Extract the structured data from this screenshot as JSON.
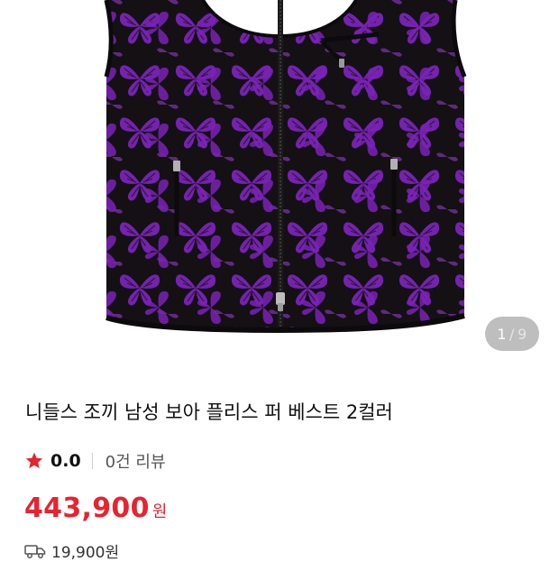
{
  "gallery": {
    "image_alt": "purple butterfly pattern fleece vest",
    "counter": {
      "current": "1",
      "separator": "/",
      "total": "9"
    }
  },
  "product": {
    "title": "니들스 조끼 남성 보아 플리스 퍼 베스트 2컬러",
    "rating": {
      "score": "0.0",
      "reviews": "0건 리뷰"
    },
    "price": {
      "amount": "443,900",
      "unit": "원"
    },
    "shipping": {
      "fee": "19,900원"
    }
  },
  "colors": {
    "price": "#e7232f",
    "star": "#e7232f",
    "vest_black": "#141014",
    "vest_purple": "#7a22b8"
  },
  "icons": {
    "star": "star-icon",
    "shipping": "delivery-truck-icon"
  }
}
